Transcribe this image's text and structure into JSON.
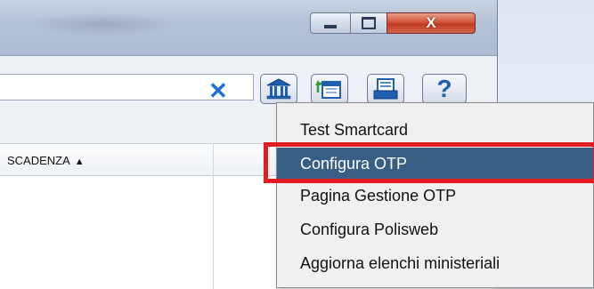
{
  "window": {
    "title_controls": {
      "minimize": "minimize",
      "maximize": "maximize",
      "close": "X"
    }
  },
  "toolbar": {
    "search_value": "",
    "clear_icon": "close-x-icon",
    "buttons": [
      "bank-icon",
      "calendar-sync-icon",
      "print-icon",
      "help-icon"
    ],
    "help_label": "?"
  },
  "table": {
    "columns": [
      {
        "label": "SCADENZA",
        "sort": "▲"
      }
    ]
  },
  "context_menu": {
    "items": [
      {
        "label": "Test Smartcard"
      },
      {
        "label": "Configura OTP"
      },
      {
        "label": "Pagina Gestione OTP"
      },
      {
        "label": "Configura Polisweb"
      },
      {
        "label": "Aggiorna elenchi ministeriali"
      }
    ],
    "selected_index": 1
  },
  "colors": {
    "selection": "#395e83",
    "highlight_box": "#e31b23",
    "clear_icon": "#1f6fd8"
  }
}
